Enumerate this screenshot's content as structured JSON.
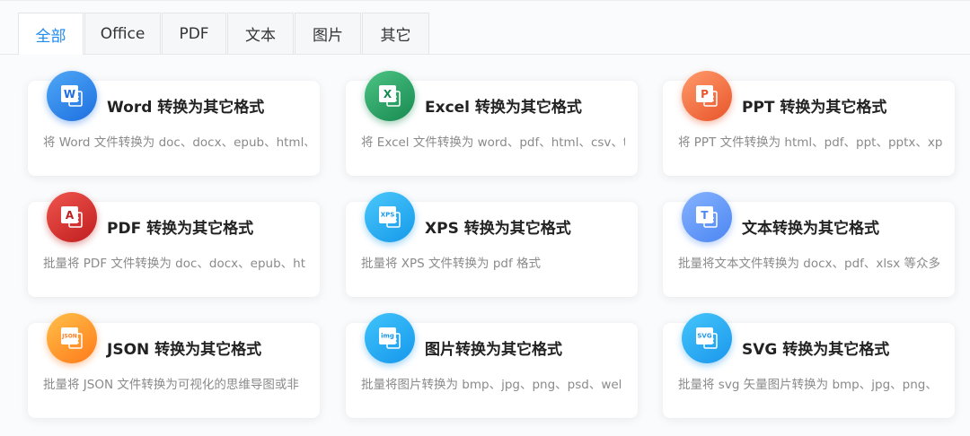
{
  "tabs": {
    "all": "全部",
    "office": "Office",
    "pdf": "PDF",
    "text": "文本",
    "image": "图片",
    "other": "其它"
  },
  "cards": [
    {
      "title": "Word 转换为其它格式",
      "desc": "将 Word 文件转换为 doc、docx、epub、html、",
      "icon": "word-icon",
      "color_from": "#4fa8f5",
      "color_to": "#1d6fe0",
      "glyph": "W"
    },
    {
      "title": "Excel 转换为其它格式",
      "desc": "将 Excel 文件转换为 word、pdf、html、csv、t",
      "icon": "excel-icon",
      "color_from": "#4cc383",
      "color_to": "#188a51",
      "glyph": "X"
    },
    {
      "title": "PPT 转换为其它格式",
      "desc": "将 PPT 文件转换为 html、pdf、ppt、pptx、xp",
      "icon": "ppt-icon",
      "color_from": "#ff9a6a",
      "color_to": "#e8552b",
      "glyph": "P"
    },
    {
      "title": "PDF 转换为其它格式",
      "desc": "批量将 PDF 文件转换为 doc、docx、epub、ht",
      "icon": "pdf-icon",
      "color_from": "#f0554e",
      "color_to": "#bf1e1e",
      "glyph": "A"
    },
    {
      "title": "XPS 转换为其它格式",
      "desc": "批量将 XPS 文件转换为 pdf 格式",
      "icon": "xps-icon",
      "color_from": "#4ac7fa",
      "color_to": "#169aea",
      "glyph": "XPS"
    },
    {
      "title": "文本转换为其它格式",
      "desc": "批量将文本文件转换为 docx、pdf、xlsx 等众多",
      "icon": "text-icon",
      "color_from": "#86b3ff",
      "color_to": "#4c86f2",
      "glyph": "T"
    },
    {
      "title": "JSON 转换为其它格式",
      "desc": "批量将 JSON 文件转换为可视化的思维导图或非",
      "icon": "json-icon",
      "color_from": "#ffc04a",
      "color_to": "#ff7a1a",
      "glyph": "JSON"
    },
    {
      "title": "图片转换为其它格式",
      "desc": "批量将图片转换为 bmp、jpg、png、psd、wel",
      "icon": "image-icon",
      "color_from": "#3fc4fb",
      "color_to": "#1797ec",
      "glyph": "img"
    },
    {
      "title": "SVG 转换为其它格式",
      "desc": "批量将 svg 矢量图片转换为 bmp、jpg、png、",
      "icon": "svg-icon",
      "color_from": "#45c5fb",
      "color_to": "#1a97ec",
      "glyph": "SVG"
    }
  ]
}
